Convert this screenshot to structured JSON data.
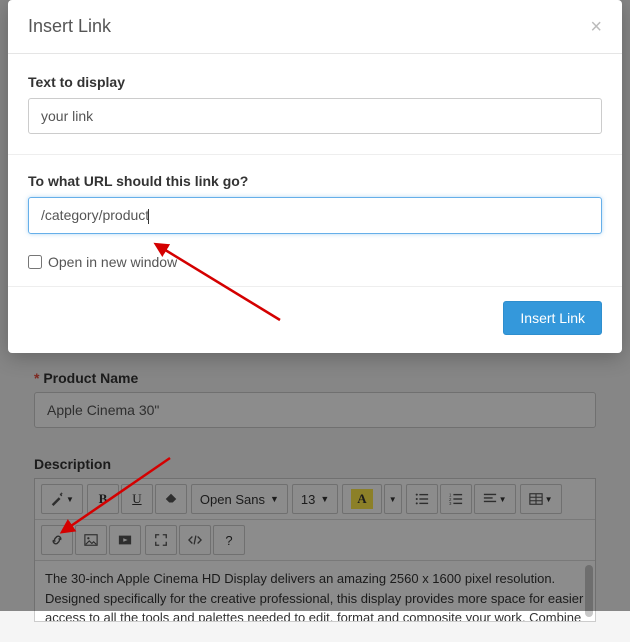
{
  "modal": {
    "title": "Insert Link",
    "text_to_display_label": "Text to display",
    "text_to_display_value": "your link",
    "url_label": "To what URL should this link go?",
    "url_value": "/category/product",
    "open_new_window_label": "Open in new window",
    "submit_label": "Insert Link"
  },
  "form": {
    "product_name_label": "Product Name",
    "product_name_value": "Apple Cinema 30\"",
    "description_label": "Description",
    "description_text": "The 30-inch Apple Cinema HD Display delivers an amazing 2560 x 1600 pixel resolution. Designed specifically for the creative professional, this display provides more space for easier access to all the tools and palettes needed to edit, format and composite your work. Combine"
  },
  "toolbar": {
    "font_family": "Open Sans",
    "font_size": "13",
    "bold": "B",
    "underline": "U",
    "font_color": "A",
    "help": "?"
  }
}
